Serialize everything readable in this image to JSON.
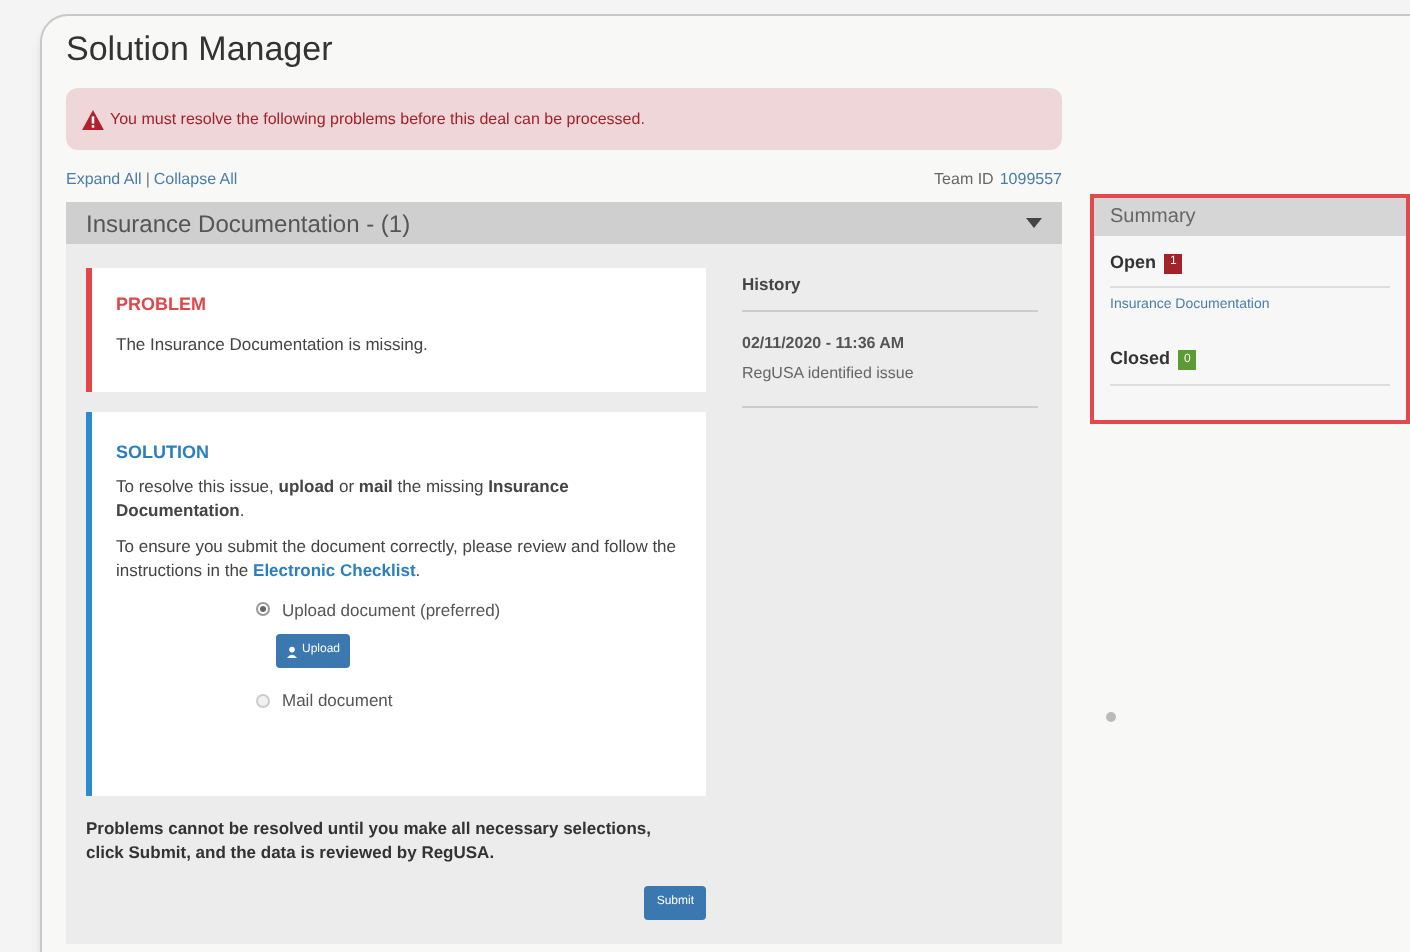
{
  "window": {
    "title": "Solution Manager"
  },
  "alert": {
    "text": "You must resolve the following problems before this deal can be processed."
  },
  "toolbar": {
    "links": [
      "Expand All",
      "Collapse All"
    ],
    "separator": "|",
    "team_label": "Team ID",
    "team_id": "1099557"
  },
  "section": {
    "title": "Insurance Documentation - (1)",
    "expanded": true
  },
  "problem": {
    "heading": "PROBLEM",
    "text": "The Insurance Documentation is missing."
  },
  "solution": {
    "heading": "SOLUTION",
    "paragraph": "To resolve this issue, **upload** or **mail** the missing **Insurance Documentation**.",
    "instructions": "To ensure you submit the document correctly, please review and follow the instructions in the",
    "link": "Electronic Checklist",
    "after_link": ".",
    "options": [
      {
        "label": "Upload document (preferred)",
        "selected": true,
        "button": "Upload"
      },
      {
        "label": "Mail document",
        "selected": false
      }
    ]
  },
  "notice": "Problems cannot be resolved until you make all necessary selections, click Submit, and the data is reviewed by RegUSA.",
  "submit": "Submit",
  "history": {
    "heading": "History",
    "entries": [
      {
        "time": "02/11/2020 - 11:36 AM",
        "text": "RegUSA identified issue"
      }
    ]
  },
  "summary": {
    "title": "Summary",
    "groups": [
      {
        "label": "Open",
        "count": "1",
        "color": "#a3222a",
        "items": [
          "Insurance Documentation"
        ]
      },
      {
        "label": "Closed",
        "count": "0",
        "color": "#5c9a33"
      }
    ]
  }
}
